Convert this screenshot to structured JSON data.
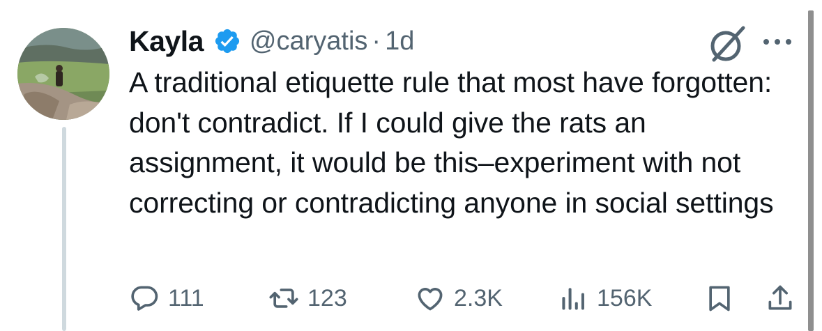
{
  "author": {
    "name": "Kayla",
    "handle": "@caryatis",
    "separator": "·",
    "time": "1d"
  },
  "tweet": {
    "text": "A traditional etiquette rule that most have forgotten: don't contradict. If I could give the rats an assignment, it would be this–experiment with not correcting or contradicting anyone in social settings"
  },
  "actions": {
    "replies": "111",
    "reposts": "123",
    "likes": "2.3K",
    "views": "156K"
  },
  "icons": [
    "verified-badge-icon",
    "grok-icon",
    "more-icon",
    "reply-icon",
    "repost-icon",
    "like-icon",
    "views-icon",
    "bookmark-icon",
    "share-icon"
  ],
  "colors": {
    "text": "#0f1419",
    "secondary": "#536471",
    "verified": "#1d9bf0",
    "thread_line": "#cfd9de"
  }
}
